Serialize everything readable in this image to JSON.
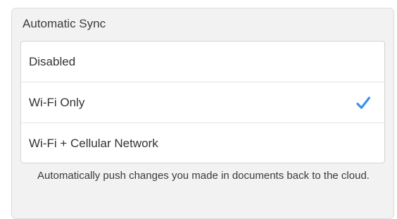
{
  "sync": {
    "title": "Automatic Sync",
    "options": [
      {
        "label": "Disabled",
        "selected": false
      },
      {
        "label": "Wi-Fi Only",
        "selected": true
      },
      {
        "label": "Wi-Fi + Cellular Network",
        "selected": false
      }
    ],
    "selected_icon": "checkmark-icon",
    "accent_color": "#3b8ff0",
    "footnote": "Automatically push changes you made in documents back to the cloud."
  }
}
